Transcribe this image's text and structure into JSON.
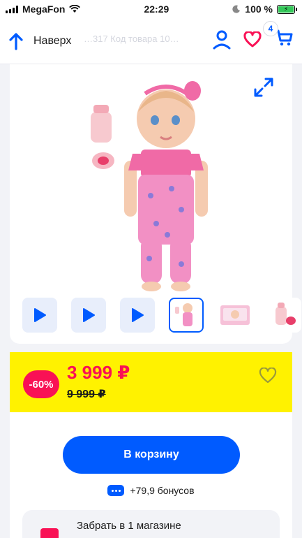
{
  "status_bar": {
    "carrier": "MegaFon",
    "time": "22:29",
    "battery": "100 %"
  },
  "header": {
    "back_label": "Наверх",
    "ghost_text": "…317          Код товара 10…",
    "cart_count": "4"
  },
  "gallery": {
    "thumbs": [
      {
        "kind": "video"
      },
      {
        "kind": "video"
      },
      {
        "kind": "video"
      },
      {
        "kind": "image",
        "selected": true
      },
      {
        "kind": "image"
      },
      {
        "kind": "image"
      }
    ]
  },
  "price": {
    "discount": "-60%",
    "current": "3 999 ₽",
    "old": "9 999 ₽"
  },
  "actions": {
    "cart_button": "В корзину",
    "bonus": "+79,9 бонусов",
    "pickup": "Забрать в 1 магазине"
  },
  "colors": {
    "accent": "#005bff",
    "sale": "#f91155",
    "price_bg": "#fff200"
  },
  "icons": [
    "wifi-icon",
    "moon-icon",
    "arrow-up-icon",
    "user-icon",
    "heart-icon",
    "cart-icon",
    "expand-icon",
    "play-icon",
    "bonus-icon",
    "store-icon"
  ]
}
